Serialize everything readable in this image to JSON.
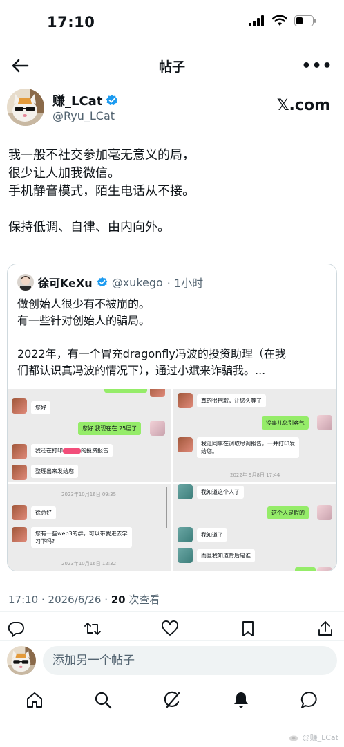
{
  "status_bar": {
    "time": "17:10"
  },
  "nav": {
    "title": "帖子"
  },
  "author": {
    "name": "赚_LCat",
    "handle": "@Ryu_LCat",
    "source": "𝕏.com"
  },
  "tweet": {
    "lines": [
      "我一般不社交参加毫无意义的局，",
      "很少让人加我微信。",
      "手机静音模式，陌生电话从不接。",
      "",
      "保持低调、自律、由内向外。"
    ]
  },
  "quote": {
    "name": "徐可KeXu",
    "handle": "@xukego",
    "time": "· 1小时",
    "lines": [
      "做创始人很少有不被崩的。",
      "有一些针对创始人的骗局。",
      "",
      "2022年，有一个冒充dragonfly冯波的投资助理（在我",
      "们都认识真冯波的情况下），通过小斌来诈骗我。..."
    ],
    "chat_left_top": {
      "b1": "您好",
      "b2": "您好 我现在在 25层了",
      "b3a": "我还在打印",
      "b3b": "的投资报告",
      "b4": "整理出来发给您"
    },
    "chat_left_bottom": {
      "ts1": "2023年10月16日 09:35",
      "b1": "徐总好",
      "b2a": "您有一些web3的群，可以带我进去学",
      "b2b": "习下吗?",
      "ts2": "2023年10月16日 12:32"
    },
    "chat_right_top": {
      "b1": "真的很抱歉，让您久等了",
      "b2": "没事儿您别客气",
      "b3a": "我让同事在调取尽调报告，一并打印发",
      "b3b": "给您。",
      "ts": "2022年 9月8日 17:44"
    },
    "chat_right_bottom": {
      "b1": "我知道这个人了",
      "b2": "这个人是假的",
      "b3": "我知道了",
      "b4": "而且我知道背后是谁"
    }
  },
  "meta": {
    "time": "17:10 · 2026/6/26 · ",
    "views": "20",
    "views_label": " 次查看"
  },
  "reply": {
    "placeholder": "添加另一个帖子"
  },
  "watermark": "@赚_LCat",
  "colors": {
    "verified": "#1d9bf0",
    "text": "#0f1419",
    "secondary": "#536471",
    "wechat_green": "#95ec69"
  }
}
